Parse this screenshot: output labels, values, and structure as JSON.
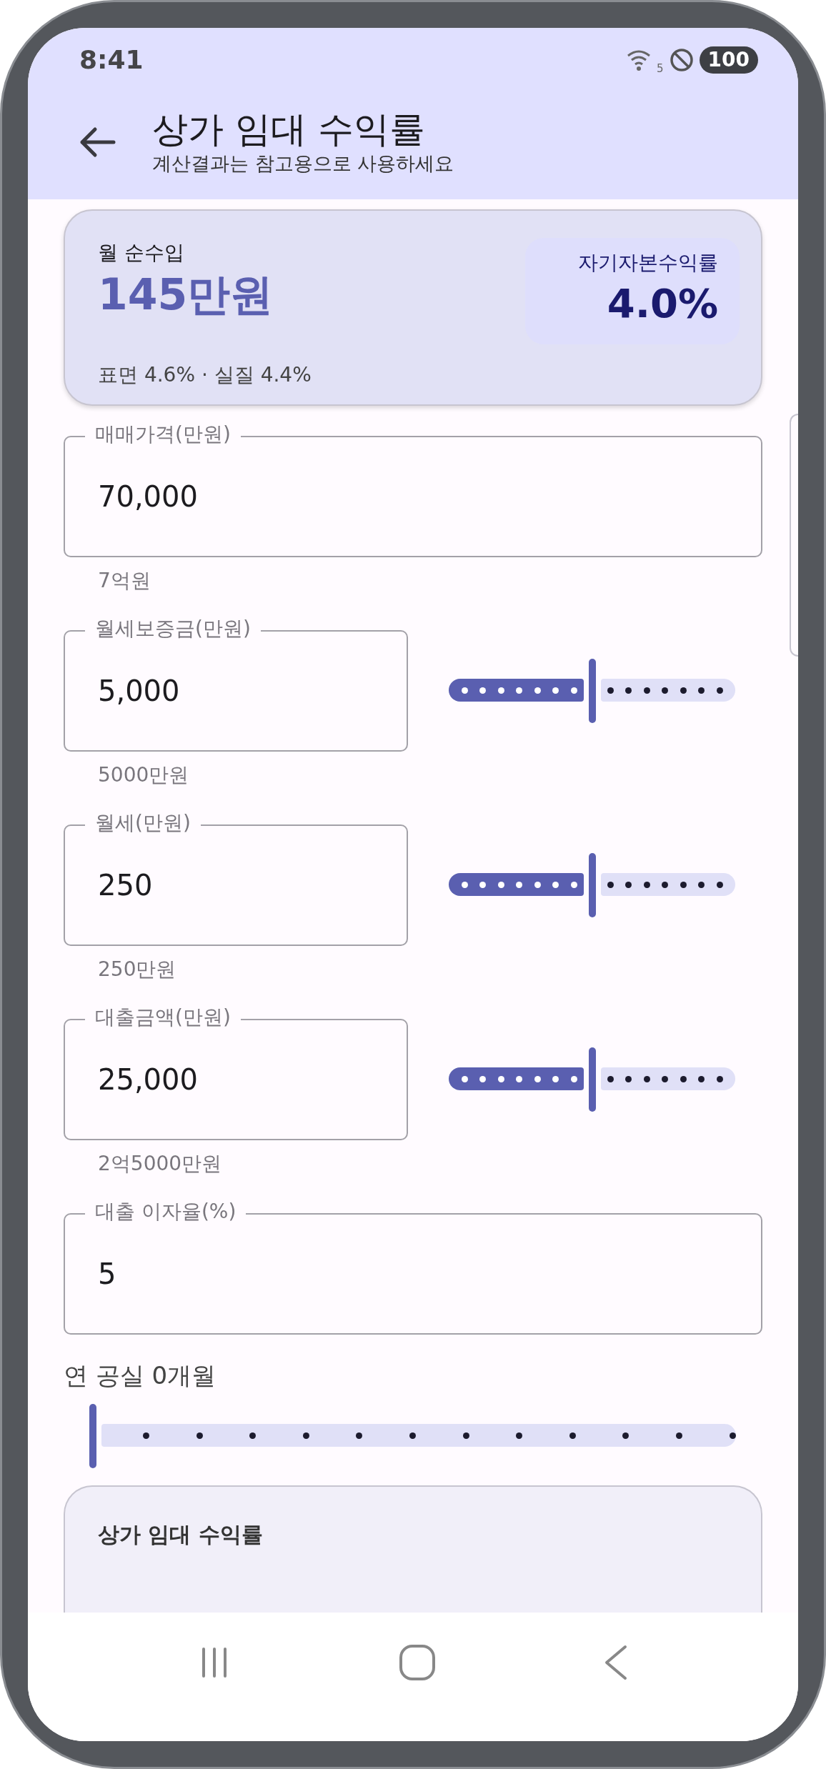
{
  "status_bar": {
    "time": "8:41",
    "wifi_label": "5",
    "battery": "100"
  },
  "header": {
    "title": "상가 임대 수익률",
    "subtitle": "계산결과는 참고용으로 사용하세요"
  },
  "summary": {
    "label": "월 순수입",
    "value": "145만원",
    "roe_label": "자기자본수익률",
    "roe_value": "4.0%",
    "detail": "표면 4.6% · 실질 4.4%"
  },
  "fields": [
    {
      "kind": "full",
      "label": "매매가격(만원)",
      "value": "70,000",
      "helper": "7억원"
    },
    {
      "kind": "slider",
      "label": "월세보증금(만원)",
      "value": "5,000",
      "helper": "5000만원",
      "level": 0.5
    },
    {
      "kind": "slider",
      "label": "월세(만원)",
      "value": "250",
      "helper": "250만원",
      "level": 0.5
    },
    {
      "kind": "slider",
      "label": "대출금액(만원)",
      "value": "25,000",
      "helper": "2억5000만원",
      "level": 0.5
    },
    {
      "kind": "full",
      "label": "대출 이자율(%)",
      "value": "5"
    }
  ],
  "vacancy": {
    "label": "연 공실 0개월",
    "level": 0
  },
  "result_card": {
    "title": "상가 임대 수익률"
  }
}
